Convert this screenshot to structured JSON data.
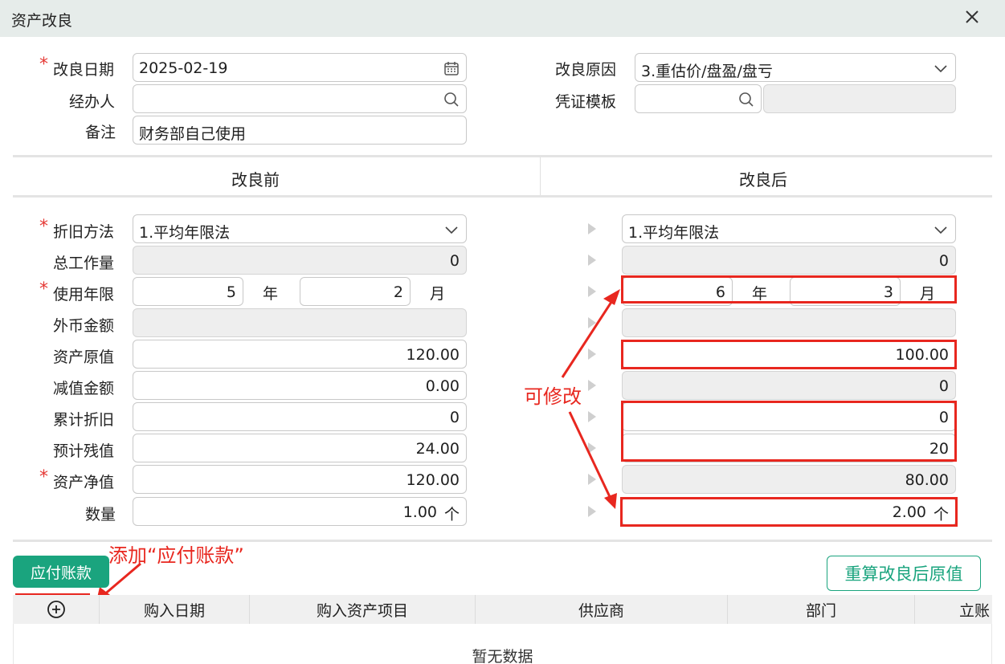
{
  "window": {
    "title": "资产改良"
  },
  "header": {
    "date_label": "改良日期",
    "date_value": "2025-02-19",
    "handler_label": "经办人",
    "handler_value": "",
    "remark_label": "备注",
    "remark_value": "财务部自己使用",
    "reason_label": "改良原因",
    "reason_value": "3.重估价/盘盈/盘亏",
    "template_label": "凭证模板",
    "template_value": ""
  },
  "sections": {
    "before": "改良前",
    "after": "改良后"
  },
  "fields": {
    "dep_method": "折旧方法",
    "total_work": "总工作量",
    "life": "使用年限",
    "foreign": "外币金额",
    "original": "资产原值",
    "impairment": "减值金额",
    "accum_dep": "累计折旧",
    "residual": "预计残值",
    "net_value": "资产净值",
    "quantity": "数量"
  },
  "units": {
    "year": "年",
    "month": "月",
    "piece": "个"
  },
  "before": {
    "dep_method": "1.平均年限法",
    "total_work": "0",
    "life_years": "5",
    "life_months": "2",
    "foreign": "",
    "original": "120.00",
    "impairment": "0.00",
    "accum_dep": "0",
    "residual": "24.00",
    "net_value": "120.00",
    "quantity": "1.00"
  },
  "after": {
    "dep_method": "1.平均年限法",
    "total_work": "0",
    "life_years": "6",
    "life_months": "3",
    "foreign": "",
    "original": "100.00",
    "impairment": "0",
    "accum_dep": "0",
    "residual": "20",
    "net_value": "80.00",
    "quantity": "2.00"
  },
  "annotations": {
    "editable": "可修改",
    "add_payable": "添加“应付账款”"
  },
  "buttons": {
    "payable": "应付账款",
    "recalc": "重算改良后原值"
  },
  "table": {
    "columns": [
      "购入日期",
      "购入资产项目",
      "供应商",
      "部门",
      "立账"
    ],
    "empty_text": "暂无数据"
  },
  "colors": {
    "accent": "#1aa47e",
    "annotation": "#e8271f",
    "required": "#e53935"
  },
  "icons": [
    "close-icon",
    "calendar-icon",
    "search-icon",
    "chevron-down-icon",
    "arrow-right-icon",
    "add-circle-icon"
  ]
}
